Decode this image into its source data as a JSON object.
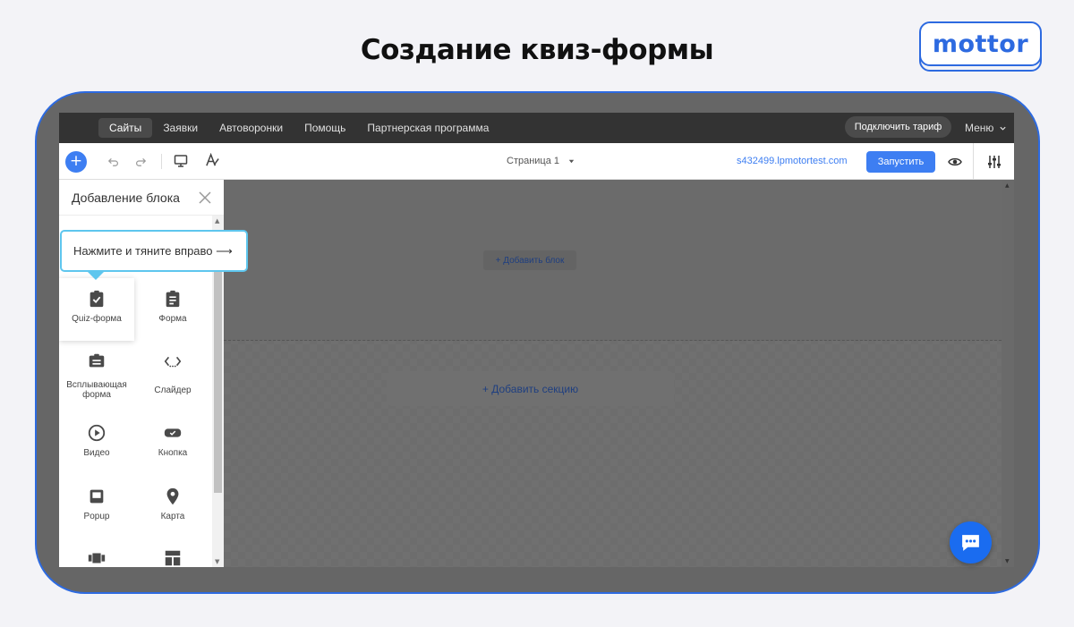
{
  "heading": "Создание квиз-формы",
  "logo": {
    "text": "mottor",
    "color": "#2d6ae0"
  },
  "topnav": {
    "items": [
      {
        "label": "Сайты",
        "active": true
      },
      {
        "label": "Заявки",
        "active": false
      },
      {
        "label": "Автоворонки",
        "active": false
      },
      {
        "label": "Помощь",
        "active": false
      },
      {
        "label": "Партнерская программа",
        "active": false
      }
    ],
    "connect_label": "Подключить тариф",
    "menu_label": "Меню"
  },
  "toolbar": {
    "add_icon": "plus-icon",
    "undo_icon": "undo-icon",
    "redo_icon": "redo-icon",
    "desktop_icon": "desktop-icon",
    "font_icon": "font-style-icon",
    "page_label": "Страница 1",
    "domain": "s432499.lpmotortest.com",
    "launch_label": "Запустить",
    "accent": "#3d7ef2"
  },
  "panel": {
    "title": "Добавление блока",
    "tiles": [
      {
        "label": "Quiz-форма",
        "icon": "clipboard-check-icon"
      },
      {
        "label": "Форма",
        "icon": "clipboard-list-icon"
      },
      {
        "label": "Всплывающая форма",
        "icon": "popup-form-icon"
      },
      {
        "label": "Слайдер",
        "icon": "slider-icon"
      },
      {
        "label": "Видео",
        "icon": "play-circle-icon"
      },
      {
        "label": "Кнопка",
        "icon": "button-icon"
      },
      {
        "label": "Popup",
        "icon": "popup-icon"
      },
      {
        "label": "Карта",
        "icon": "map-pin-icon"
      }
    ]
  },
  "tooltip": "Нажмите и тяните вправо ⟶",
  "canvas": {
    "add_block_label": "+ Добавить блок",
    "add_section_label": "+ Добавить секцию"
  }
}
